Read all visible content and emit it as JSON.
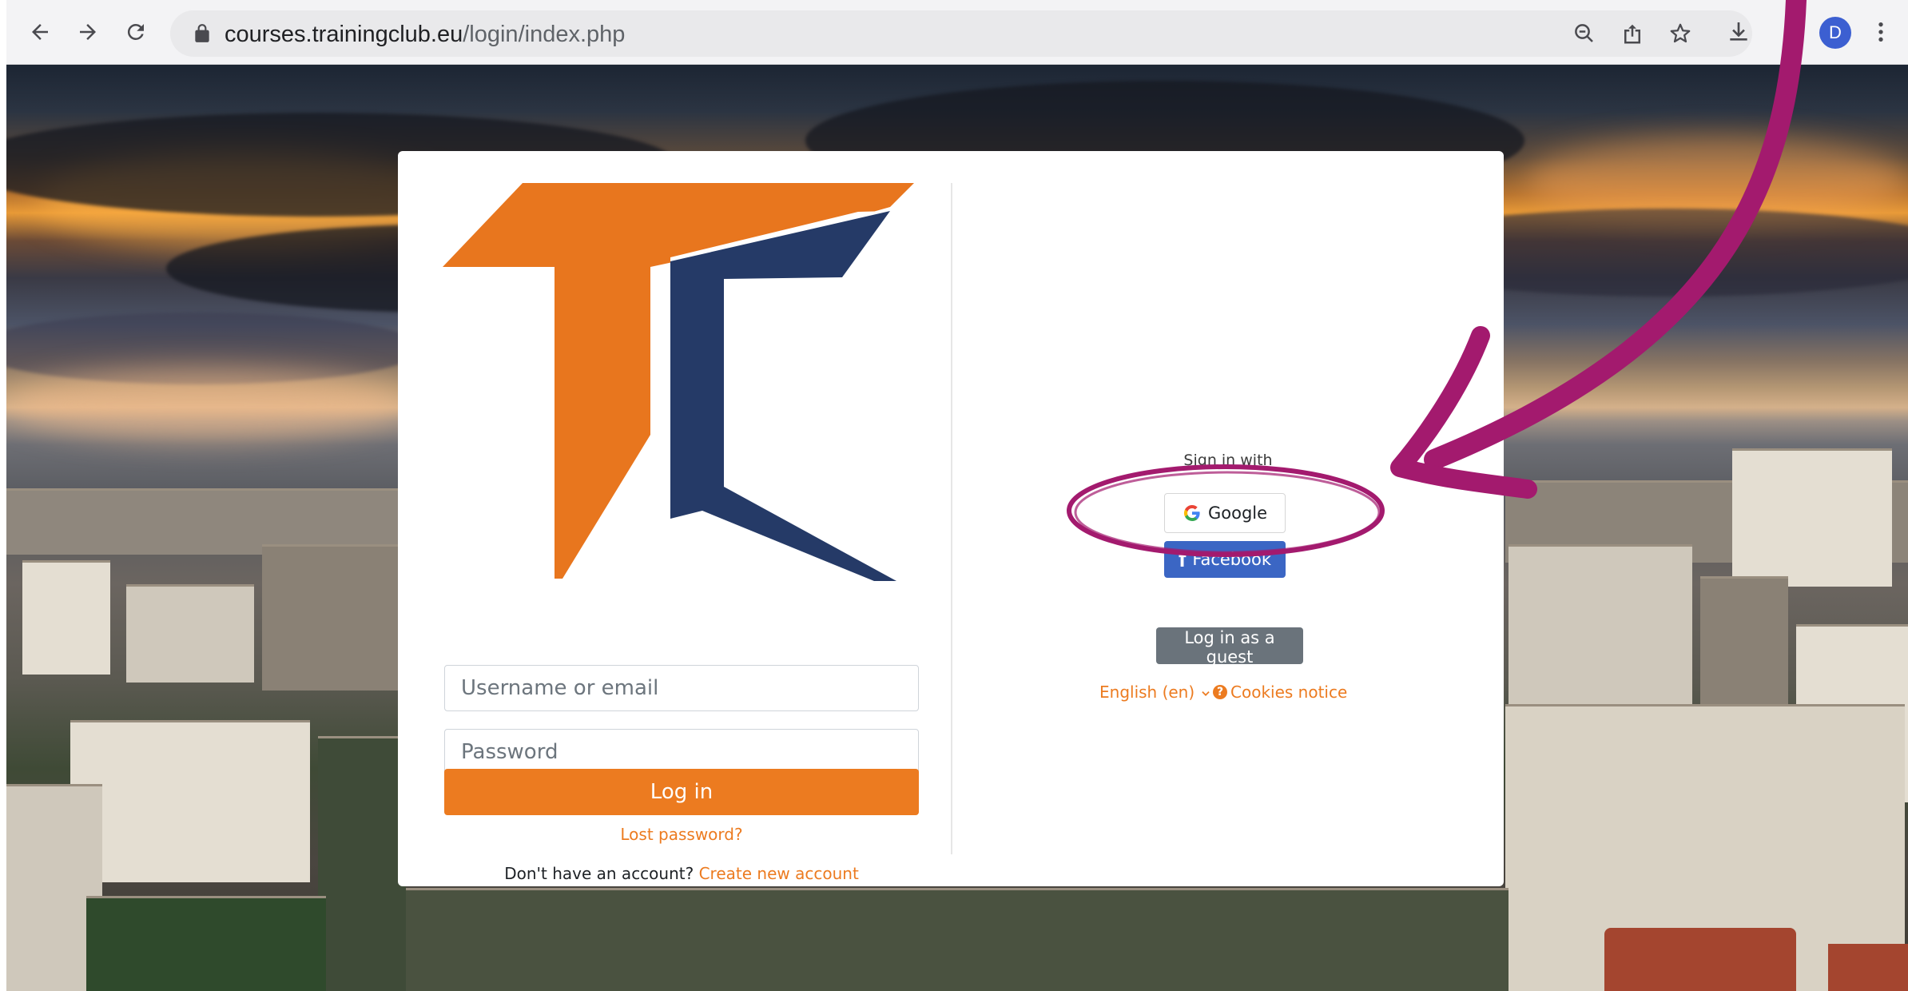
{
  "browser": {
    "url_domain": "courses.trainingclub.eu",
    "url_path": "/login/index.php",
    "profile_initial": "D"
  },
  "login": {
    "username_placeholder": "Username or email",
    "password_placeholder": "Password",
    "login_button": "Log in",
    "lost_password": "Lost password?",
    "no_account": "Don't have an account?",
    "create_account": "Create new account"
  },
  "social": {
    "title": "Sign in with",
    "google": "Google",
    "facebook": "Facebook"
  },
  "guest_button": "Log in as a guest",
  "footer": {
    "language": "English (en)",
    "cookies": "Cookies notice"
  },
  "colors": {
    "accent_orange": "#ec7b20",
    "logo_navy": "#253a67",
    "annotation_magenta": "#a31a6e",
    "facebook_blue": "#3b66c4",
    "guest_grey": "#6a737b"
  },
  "icons": [
    "back-arrow-icon",
    "forward-arrow-icon",
    "reload-icon",
    "lock-icon",
    "zoom-out-icon",
    "share-icon",
    "star-icon",
    "download-icon",
    "menu-dots-icon",
    "google-g-icon",
    "facebook-f-icon",
    "help-circle-icon",
    "chevron-down-icon"
  ]
}
